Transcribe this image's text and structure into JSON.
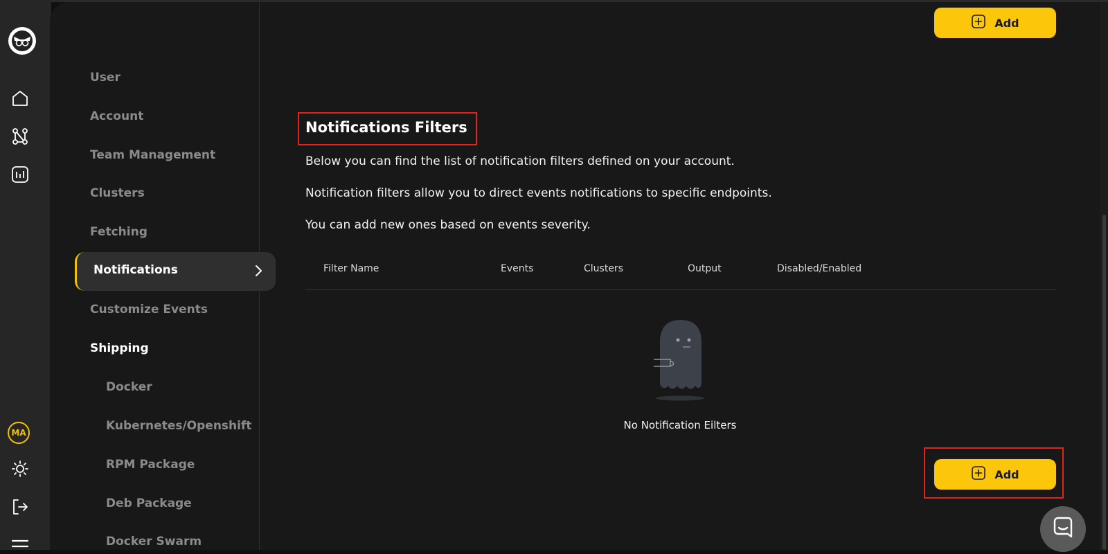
{
  "colors": {
    "accent": "#fcc60b",
    "highlight_box": "#e0261a",
    "background": "#181818",
    "rail": "#262626"
  },
  "rail": {
    "logo_icon": "owl-logo-icon",
    "icons": [
      "home-icon",
      "workflow-icon",
      "chart-icon"
    ],
    "avatar_initials": "MA",
    "bottom_icons": [
      "sun-icon",
      "logout-icon",
      "menu-icon"
    ]
  },
  "sidebar": {
    "items": [
      {
        "label": "User"
      },
      {
        "label": "Account"
      },
      {
        "label": "Team Management"
      },
      {
        "label": "Clusters"
      },
      {
        "label": "Fetching"
      },
      {
        "label": "Notifications",
        "active": true
      },
      {
        "label": "Customize Events"
      },
      {
        "label": "Shipping",
        "heading": true
      },
      {
        "label": "Docker",
        "sub": true
      },
      {
        "label": "Kubernetes/Openshift",
        "sub": true
      },
      {
        "label": "RPM Package",
        "sub": true
      },
      {
        "label": "Deb Package",
        "sub": true
      },
      {
        "label": "Docker Swarm",
        "sub": true
      }
    ]
  },
  "main": {
    "top_button": {
      "label": "Add",
      "icon": "plus-square-icon"
    },
    "title": "Notifications Filters",
    "paragraphs": [
      "Below you can find the list of notification filters defined on your account.",
      "Notification filters allow you to direct events notifications to specific endpoints.",
      "You can add new ones based on events severity."
    ],
    "table": {
      "columns": [
        "Filter Name",
        "Events",
        "Clusters",
        "Output",
        "Disabled/Enabled"
      ],
      "rows": []
    },
    "empty_state": {
      "icon": "ghost-icon",
      "text": "No Notification Eilters"
    },
    "bottom_button": {
      "label": "Add",
      "icon": "plus-square-icon"
    }
  },
  "chat_widget": {
    "icon": "chat-icon"
  }
}
